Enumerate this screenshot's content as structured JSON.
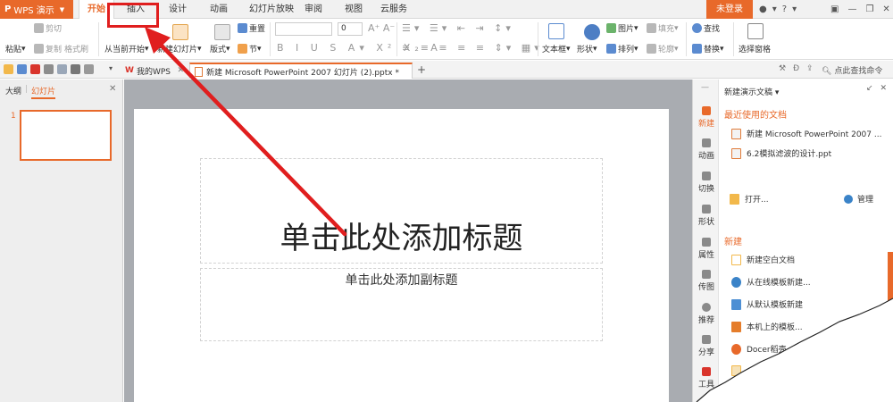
{
  "app": {
    "logo": "P",
    "name": "WPS 演示"
  },
  "menu_tabs": [
    {
      "label": "开始",
      "active": true
    },
    {
      "label": "插入",
      "active": false
    },
    {
      "label": "设计",
      "active": false
    },
    {
      "label": "动画",
      "active": false
    },
    {
      "label": "幻灯片放映",
      "active": false
    },
    {
      "label": "审阅",
      "active": false
    },
    {
      "label": "视图",
      "active": false
    },
    {
      "label": "云服务",
      "active": false
    }
  ],
  "login_label": "未登录",
  "ribbon": {
    "paste": "粘贴",
    "cut": "剪切",
    "copy": "复制",
    "format_painter": "格式刷",
    "from_current": "从当前开始",
    "new_slide": "新建幻灯片",
    "layout": "版式",
    "section": "节",
    "reset": "重置",
    "font_size": "0",
    "textbox": "文本框",
    "shape": "形状",
    "picture": "图片",
    "fill": "填充",
    "arrange": "排列",
    "outline": "轮廓",
    "find": "查找",
    "replace": "替换",
    "selection_pane": "选择窗格"
  },
  "doc_tabs": {
    "wps_tab": "我的WPS",
    "current_tab": "新建 Microsoft PowerPoint 2007 幻灯片 (2).pptx *",
    "add": "+"
  },
  "search_command": "点此查找命令",
  "left_pane": {
    "tab_outline": "大纲",
    "tab_slides": "幻灯片",
    "slide_number": "1"
  },
  "slide": {
    "title_placeholder": "单击此处添加标题",
    "subtitle_placeholder": "单击此处添加副标题"
  },
  "vertical_strip": [
    "新建",
    "动画",
    "切换",
    "形状",
    "属性",
    "传图",
    "推荐",
    "分享",
    "工具"
  ],
  "task_pane": {
    "header": "新建演示文稿",
    "recent_title": "最近使用的文档",
    "recent_docs": [
      "新建 Microsoft PowerPoint 2007 ...",
      "6.2模拟滤波的设计.ppt"
    ],
    "open": "打开...",
    "manage": "管理",
    "new_title": "新建",
    "new_items": [
      "新建空白文档",
      "从在线模板新建...",
      "从默认模板新建",
      "本机上的模板...",
      "Docer稻壳..."
    ]
  },
  "colors": {
    "accent": "#e8692a",
    "annotation": "#e01e1e"
  }
}
